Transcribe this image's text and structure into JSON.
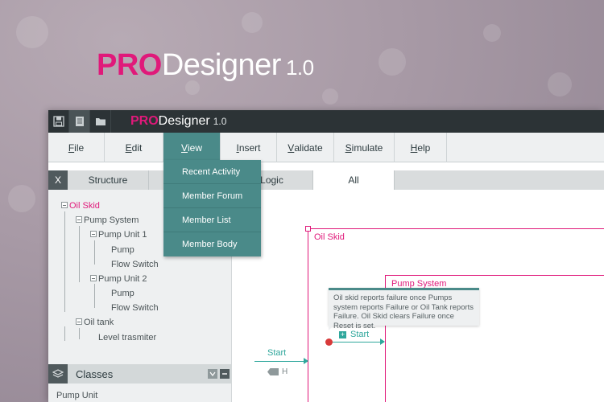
{
  "hero": {
    "pro": "PRO",
    "designer": "Designer",
    "version": "1.0"
  },
  "app": {
    "title_pro": "PRO",
    "title_designer": "Designer",
    "title_version": "1.0"
  },
  "toolbar": {
    "icons": [
      "save-icon",
      "document-icon",
      "folder-icon"
    ]
  },
  "menu": {
    "items": [
      {
        "label": "File",
        "underline": "F",
        "rest": "ile"
      },
      {
        "label": "Edit",
        "underline": "E",
        "rest": "dit"
      },
      {
        "label": "View",
        "underline": "V",
        "rest": "iew"
      },
      {
        "label": "Insert",
        "underline": "I",
        "rest": "nsert"
      },
      {
        "label": "Validate",
        "underline": "V",
        "rest": "alidate"
      },
      {
        "label": "Simulate",
        "underline": "S",
        "rest": "imulate"
      },
      {
        "label": "Help",
        "underline": "H",
        "rest": "elp"
      }
    ],
    "active": "View"
  },
  "view_dropdown": {
    "items": [
      "Recent Activity",
      "Member Forum",
      "Member List",
      "Member Body"
    ]
  },
  "tabs": {
    "close": "X",
    "items": [
      "Structure",
      "",
      "Logic",
      "All"
    ],
    "active": "All"
  },
  "tree": {
    "oil_skid": "Oil Skid",
    "pump_system": "Pump System",
    "pump_unit_1": "Pump Unit 1",
    "pump_1": "Pump",
    "flow_switch_1": "Flow Switch",
    "pump_unit_2": "Pump Unit 2",
    "pump_2": "Pump",
    "flow_switch_2": "Flow Switch",
    "oil_tank": "Oil tank",
    "level_transmitter": "Level trasmiter"
  },
  "classes": {
    "label": "Classes",
    "first_item": "Pump Unit"
  },
  "canvas": {
    "oil_skid_label": "Oil Skid",
    "pump_system_label": "Pump System",
    "tooltip": "Oil skid reports failure once Pumps system reports Failure or Oil Tank reports Failure. Oil Skid clears Failure once Reset is set.",
    "inner_start": "Start",
    "outer_start": "Start",
    "h_tag": "H"
  },
  "colors": {
    "accent": "#e0197a",
    "teal": "#4a8a89",
    "flow": "#2fa79c",
    "titlebar": "#2c3336"
  }
}
